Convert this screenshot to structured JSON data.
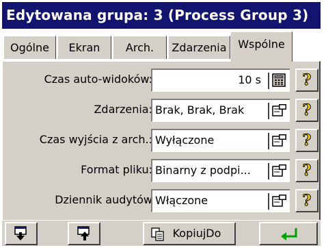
{
  "title": "Edytowana grupa: 3 (Process Group 3)",
  "tabs": [
    {
      "label": "Ogólne",
      "active": false
    },
    {
      "label": "Ekran",
      "active": false
    },
    {
      "label": "Arch.",
      "active": false
    },
    {
      "label": "Zdarzenia",
      "active": false
    },
    {
      "label": "Wspólne",
      "active": true
    }
  ],
  "rows": [
    {
      "label": "Czas auto-widoków:",
      "value": "10 s",
      "button_icon": "calculator-icon"
    },
    {
      "label": "Zdarzenia:",
      "value": "Brak, Brak, Brak",
      "button_icon": "edit-dialog-icon"
    },
    {
      "label": "Czas wyjścia z arch.:",
      "value": "Wyłączone",
      "button_icon": "edit-dialog-icon"
    },
    {
      "label": "Format pliku:",
      "value": "Binarny z podpi...",
      "button_icon": "edit-dialog-icon"
    },
    {
      "label": "Dziennik audytów",
      "value": "Włączone",
      "button_icon": "edit-dialog-icon"
    }
  ],
  "help_glyph": "?",
  "bottom": {
    "copy_label": "KopiujDo",
    "buttons": [
      "download-icon",
      "upload-icon",
      "copy-icon",
      "enter-icon"
    ]
  },
  "colors": {
    "title_bg": "#12146f",
    "panel_bg": "#d4d0c8",
    "help_fill": "#ffd700",
    "enter_arrow": "#00a000"
  }
}
